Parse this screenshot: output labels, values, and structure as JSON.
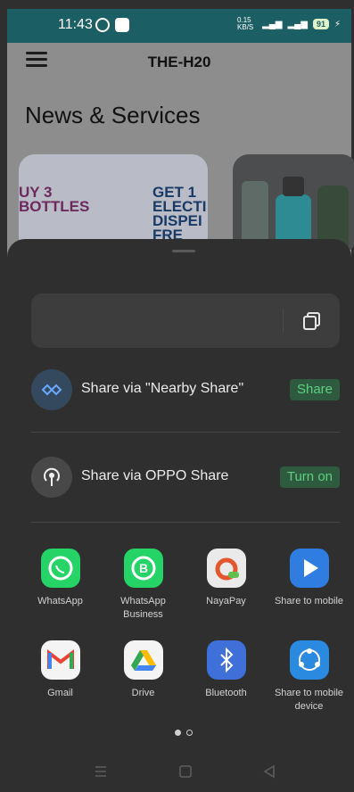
{
  "status_bar": {
    "time": "11:43",
    "net_speed": "0.15 KB/S",
    "battery": "91"
  },
  "header": {
    "title": "THE-H20"
  },
  "page": {
    "title": "News & Services"
  },
  "promo": {
    "card1_left": "UY 3\nBOTTLES",
    "card1_right": "GET 1\nELECTI\nDISPEI\nFRE"
  },
  "share_sheet": {
    "nearby": {
      "label": "Share via \"Nearby Share\"",
      "button": "Share"
    },
    "oppo": {
      "label": "Share via OPPO Share",
      "button": "Turn on"
    },
    "apps": [
      {
        "label": "WhatsApp"
      },
      {
        "label": "WhatsApp Business"
      },
      {
        "label": "NayaPay"
      },
      {
        "label": "Share to mobile"
      },
      {
        "label": "Gmail"
      },
      {
        "label": "Drive"
      },
      {
        "label": "Bluetooth"
      },
      {
        "label": "Share to mobile device"
      }
    ]
  },
  "colors": {
    "accent_green": "#5fcf80",
    "sheet_bg": "#2f2f2f",
    "status_bar": "#1b5e63"
  }
}
